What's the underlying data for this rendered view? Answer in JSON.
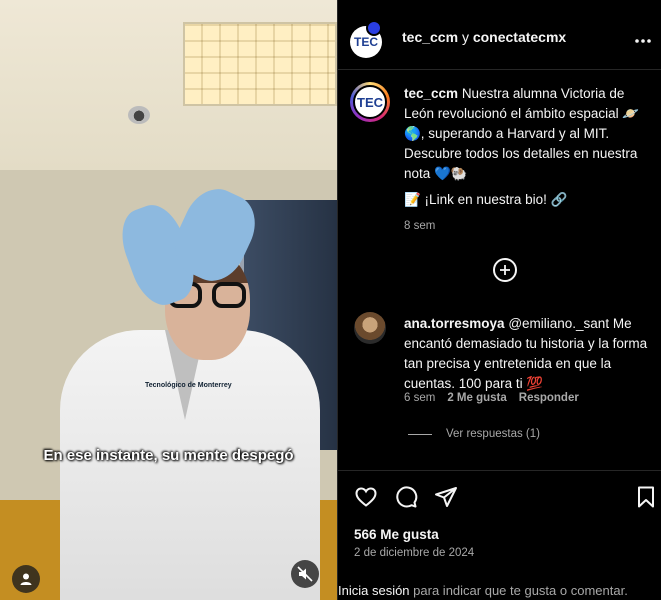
{
  "media": {
    "subtitle": "En ese instante, su mente despegó",
    "patch_text": "Tecnológico de Monterrey",
    "user_icon": "user-icon",
    "mute_icon": "muted-speaker-icon"
  },
  "header": {
    "avatar_text": "TEC",
    "account": "tec_ccm",
    "joiner": "y",
    "collab": "conectatecmx",
    "more_icon": "more-options-icon"
  },
  "caption": {
    "avatar_text": "TEC",
    "username": "tec_ccm",
    "text": "Nuestra alumna Victoria de León revolucionó el ámbito espacial 🪐🌎, superando a Harvard y al MIT. Descubre todos los detalles en nuestra nota 💙🐏",
    "link_text": "📝 ¡Link en nuestra bio! 🔗",
    "time": "8 sem"
  },
  "comment": {
    "username": "ana.torresmoya",
    "text": "@emiliano._sant Me encantó demasiado tu historia y la forma tan precisa y entretenida en que la cuentas. 100 para ti 💯",
    "time": "6 sem",
    "likes": "2 Me gusta",
    "reply": "Responder",
    "view_replies": "Ver respuestas (1)"
  },
  "actions": {
    "likes": "566 Me gusta",
    "date": "2 de diciembre de 2024",
    "login_link": "Inicia sesión",
    "login_rest": "para indicar que te gusta o comentar."
  },
  "colors": {
    "background": "#000000",
    "text": "#f5f5f5",
    "muted": "#a8a8a8",
    "divider": "#262626"
  }
}
